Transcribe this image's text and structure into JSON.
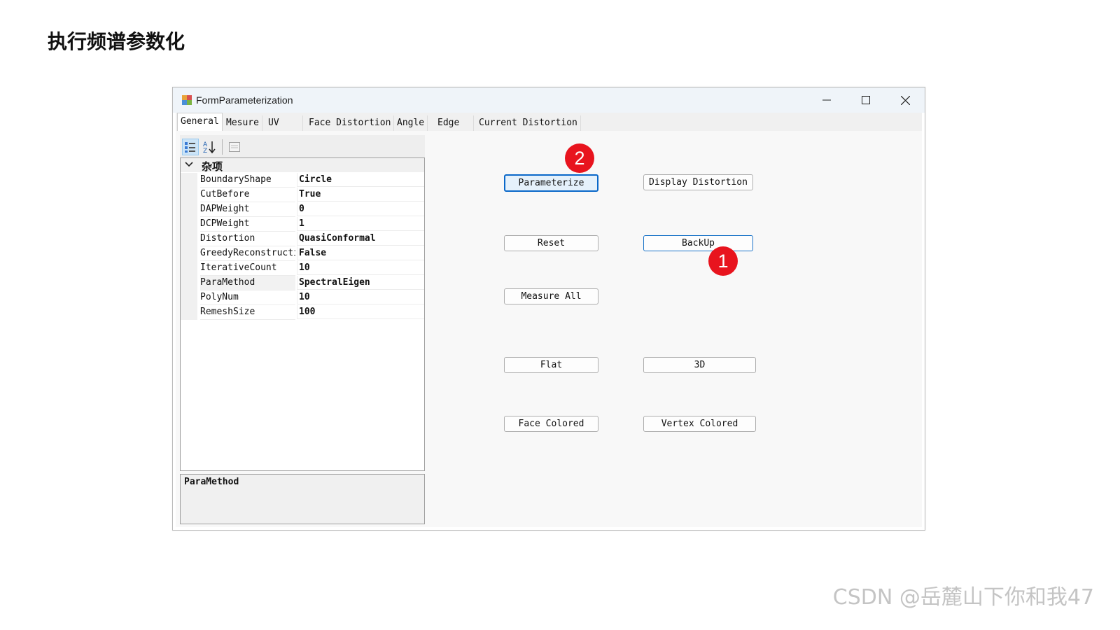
{
  "slide": {
    "title": "执行频谱参数化"
  },
  "window": {
    "title": "FormParameterization",
    "controls": {
      "minimize": "minimize-icon",
      "maximize": "maximize-icon",
      "close": "close-icon"
    }
  },
  "tabs": [
    {
      "label": "General",
      "active": true
    },
    {
      "label": "Mesure"
    },
    {
      "label": "UV"
    },
    {
      "label": "Face Distortion"
    },
    {
      "label": "Angle"
    },
    {
      "label": "Edge"
    },
    {
      "label": "Current Distortion"
    }
  ],
  "property_grid": {
    "toolbar": [
      "categorized-icon",
      "alphabetical-sort-icon",
      "property-pages-icon"
    ],
    "category": "杂项",
    "properties": [
      {
        "name": "BoundaryShape",
        "value": "Circle"
      },
      {
        "name": "CutBefore",
        "value": "True"
      },
      {
        "name": "DAPWeight",
        "value": "0"
      },
      {
        "name": "DCPWeight",
        "value": "1"
      },
      {
        "name": "Distortion",
        "value": "QuasiConformal"
      },
      {
        "name": "GreedyReconstructi",
        "value": "False"
      },
      {
        "name": "IterativeCount",
        "value": "10"
      },
      {
        "name": "ParaMethod",
        "value": "SpectralEigen"
      },
      {
        "name": "PolyNum",
        "value": "10"
      },
      {
        "name": "RemeshSize",
        "value": "100"
      }
    ],
    "selected_property": "ParaMethod",
    "description_title": "ParaMethod"
  },
  "buttons": {
    "parameterize": "Parameterize",
    "display_distortion": "Display Distortion",
    "reset": "Reset",
    "backup": "BackUp",
    "measure_all": "Measure All",
    "flat": "Flat",
    "three_d": "3D",
    "face_colored": "Face Colored",
    "vertex_colored": "Vertex Colored"
  },
  "annotations": {
    "marker_1": "1",
    "marker_2": "2",
    "color": "#e8141e"
  },
  "watermark": "CSDN @岳麓山下你和我47",
  "colors": {
    "accent": "#0a68c9",
    "titlebar": "#eff4f9"
  }
}
